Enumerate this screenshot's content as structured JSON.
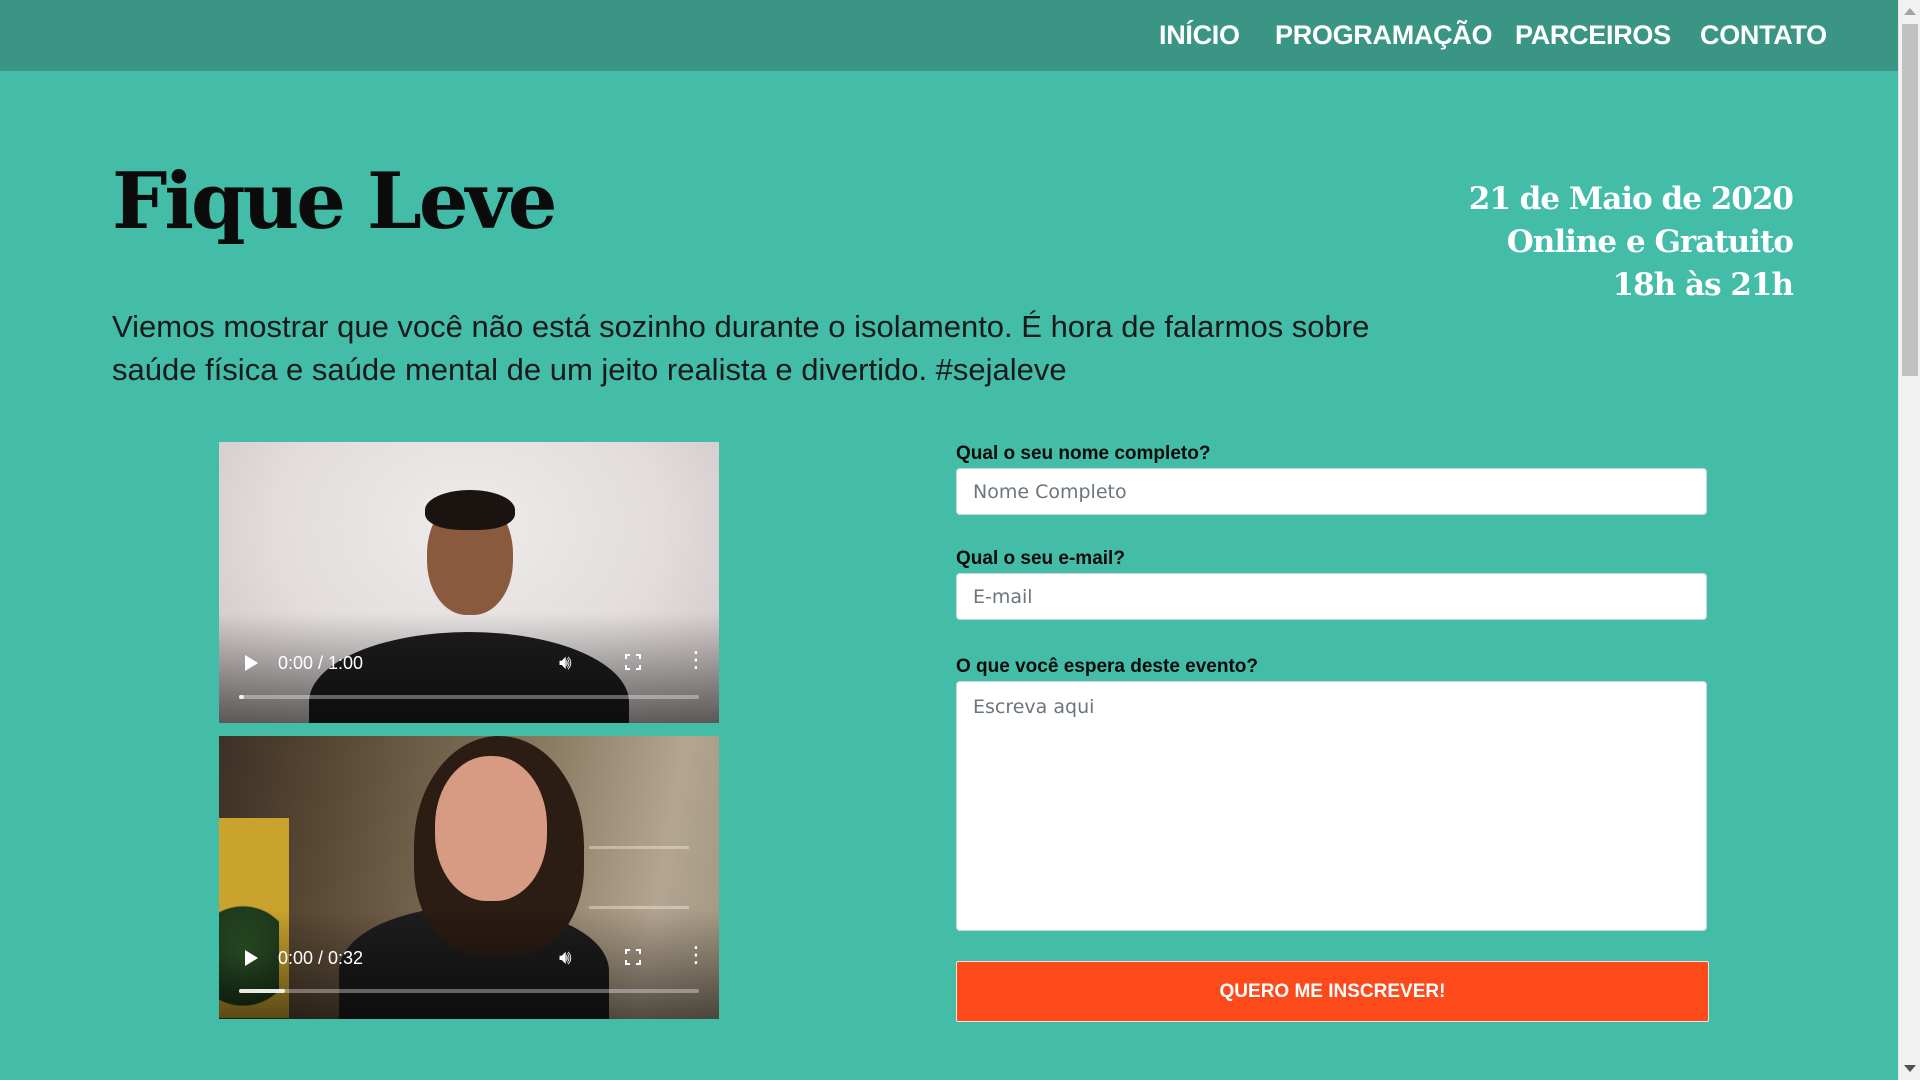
{
  "nav": {
    "items": [
      {
        "label": "INÍCIO"
      },
      {
        "label": "PROGRAMAÇÃO"
      },
      {
        "label": "PARCEIROS"
      },
      {
        "label": "CONTATO"
      }
    ]
  },
  "hero": {
    "title": "Fique Leve",
    "event_date": "21 de Maio de 2020",
    "event_mode": "Online e Gratuito",
    "event_time": "18h às 21h",
    "description": "Viemos mostrar que você não está sozinho durante o isolamento. É hora de falarmos sobre saúde física e saúde mental de um jeito realista e divertido. #sejaleve"
  },
  "videos": [
    {
      "time": "0:00 / 1:00",
      "progress": 0.01
    },
    {
      "time": "0:00 / 0:32",
      "progress": 0.1
    }
  ],
  "form": {
    "name_label": "Qual o seu nome completo?",
    "name_placeholder": "Nome Completo",
    "email_label": "Qual o seu e-mail?",
    "email_placeholder": "E-mail",
    "expect_label": "O que você espera deste evento?",
    "expect_placeholder": "Escreva aqui",
    "submit_label": "QUERO ME INSCREVER!"
  },
  "icons": {
    "play": "play-icon",
    "volume": "volume-icon",
    "fullscreen": "fullscreen-icon",
    "more": "more-vertical-icon"
  },
  "colors": {
    "background": "#43bca8",
    "navbar": "#3b9585",
    "submit": "#fd4a1b"
  }
}
